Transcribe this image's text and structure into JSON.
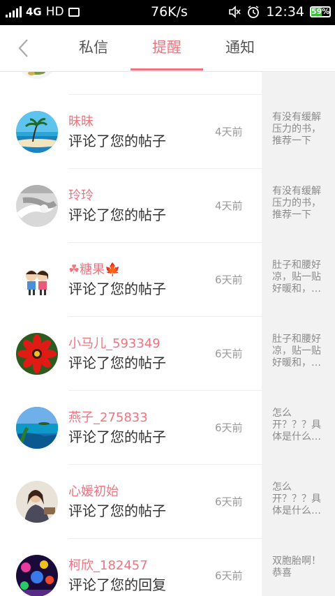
{
  "status_bar": {
    "network": "4G",
    "hd": "HD",
    "speed": "76K/s",
    "time": "12:34",
    "battery": "59%",
    "battery_level": 0.59
  },
  "nav": {
    "back_icon": "chevron-left-icon",
    "tabs": [
      {
        "label": "私信",
        "active": false
      },
      {
        "label": "提醒",
        "active": true
      },
      {
        "label": "通知",
        "active": false
      }
    ]
  },
  "colors": {
    "accent": "#f07480",
    "preview_bg": "#f2f2f2"
  },
  "items": [
    {
      "name": "昧昧",
      "action": "评论了您的帖子",
      "time": "4天前",
      "preview": "有没有缓解压力的书，推荐一下",
      "avatar": "beach-avatar"
    },
    {
      "name": "玲玲",
      "action": "评论了您的帖子",
      "time": "4天前",
      "preview": "有没有缓解压力的书，推荐一下",
      "avatar": "hands-avatar"
    },
    {
      "name": "☘糖果🍁",
      "action": "评论了您的帖子",
      "time": "6天前",
      "preview": "肚子和腰好凉，贴一贴好暖和，…",
      "avatar": "cartoon-couple-avatar"
    },
    {
      "name": "小马儿_593349",
      "action": "评论了您的帖子",
      "time": "6天前",
      "preview": "肚子和腰好凉，贴一贴好暖和，…",
      "avatar": "red-flower-avatar"
    },
    {
      "name": "燕子_275833",
      "action": "评论了您的帖子",
      "time": "6天前",
      "preview": "怎么开？？？具体是什么…",
      "avatar": "island-avatar"
    },
    {
      "name": "心媛初始",
      "action": "评论了您的帖子",
      "time": "6天前",
      "preview": "怎么开？？？具体是什么…",
      "avatar": "person-avatar"
    },
    {
      "name": "柯欣_182457",
      "action": "评论了您的回复",
      "time": "6天前",
      "preview": "双胞胎啊！恭喜",
      "avatar": "festival-lights-avatar"
    }
  ]
}
